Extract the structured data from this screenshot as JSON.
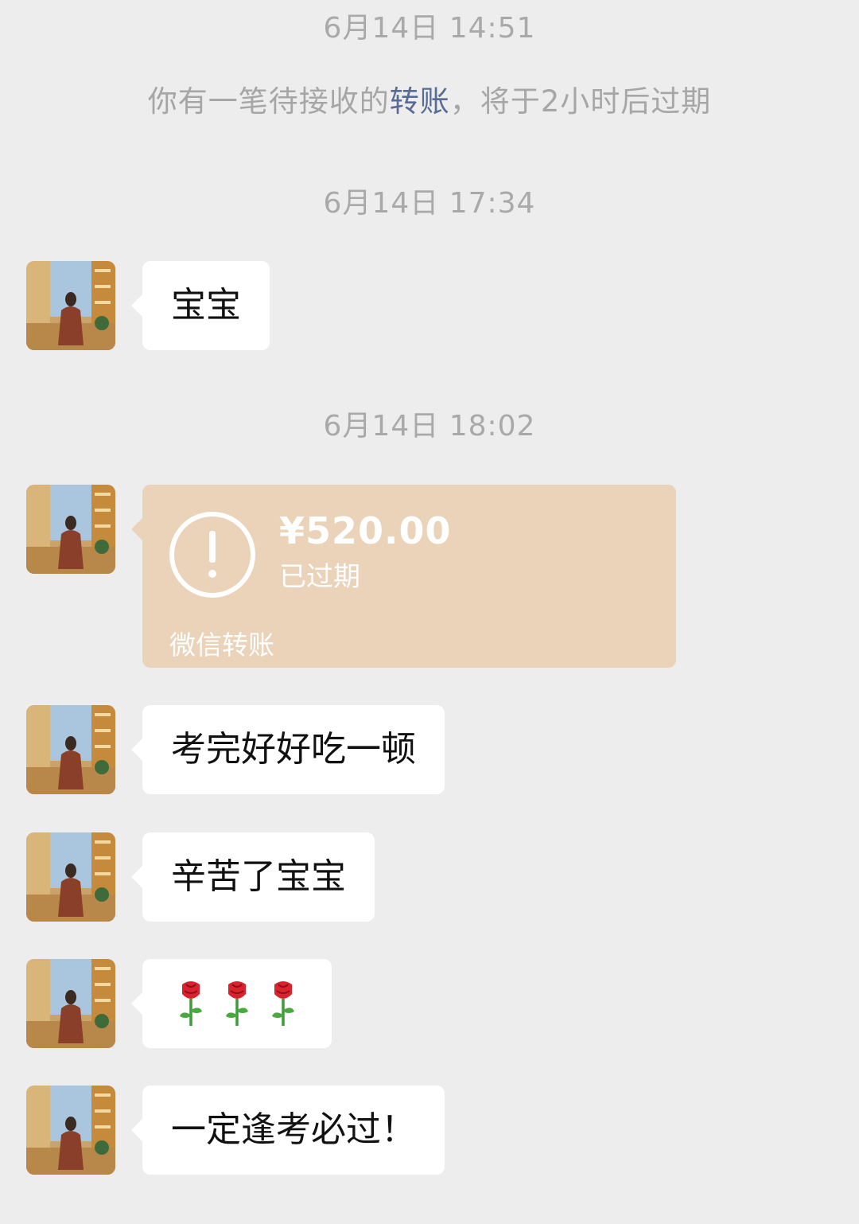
{
  "timestamps": [
    "6月14日 14:51",
    "6月14日 17:34",
    "6月14日 18:02"
  ],
  "system_notice": {
    "prefix": "你有一笔待接收的",
    "link": "转账",
    "suffix": "，将于2小时后过期"
  },
  "messages": {
    "m1": "宝宝",
    "m3": "考完好好吃一顿",
    "m4": "辛苦了宝宝",
    "m6": "一定逢考必过！"
  },
  "transfer": {
    "amount": "¥520.00",
    "status": "已过期",
    "label": "微信转账",
    "icon": "exclamation-circle-icon"
  },
  "emoji_message": {
    "icons": [
      "rose-icon",
      "rose-icon",
      "rose-icon"
    ]
  },
  "colors": {
    "background": "#ededed",
    "link": "#576b95",
    "transfer_expired": "#ead3b9",
    "bubble": "#ffffff"
  }
}
